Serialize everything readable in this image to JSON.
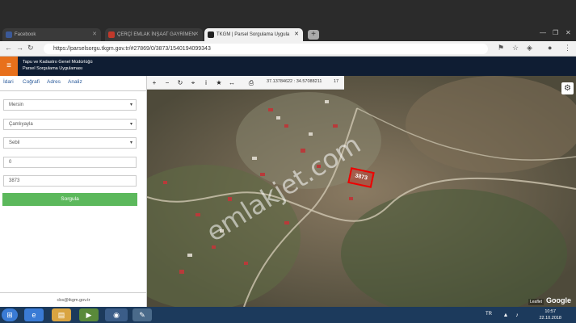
{
  "browser": {
    "tabs": [
      {
        "title": "Facebook",
        "favicon_color": "#3b5998"
      },
      {
        "title": "ÇERÇİ EMLAK İNŞAAT GAYRİMEN",
        "favicon_color": "#c0392b"
      },
      {
        "title": "TKGM | Parsel Sorgulama Uygula",
        "favicon_color": "#222222"
      }
    ],
    "url": "https://parselsorgu.tkgm.gov.tr/#27869/0/3873/1540194099343",
    "window_buttons": {
      "minimize": "—",
      "maximize": "❐",
      "close": "✕"
    }
  },
  "app": {
    "title_line1": "Tapu ve Kadastro Genel Müdürlüğü",
    "title_line2": "Parsel Sorgulama Uygulaması",
    "accent_color": "#e8701b",
    "header_color": "#0f1d33"
  },
  "sidebar": {
    "tabs": [
      "İdari",
      "Coğrafi",
      "Adres",
      "Analiz"
    ],
    "fields": {
      "il": "Mersin",
      "ilce": "Çamlıyayla",
      "mahalle": "Sebil",
      "ada": "0",
      "parsel": "3873"
    },
    "query_button": "Sorgula",
    "footer_email": "cbs@tkgm.gov.tr"
  },
  "map": {
    "coordinates": "37.13784622 : 34.57088211",
    "zoom": "17",
    "parcel_label": "3873",
    "watermark": "emlakjet.com",
    "legal": "Leaflet",
    "google": "Google"
  },
  "taskbar": {
    "language": "TR",
    "time": "10:57",
    "date": "22.10.2018"
  }
}
